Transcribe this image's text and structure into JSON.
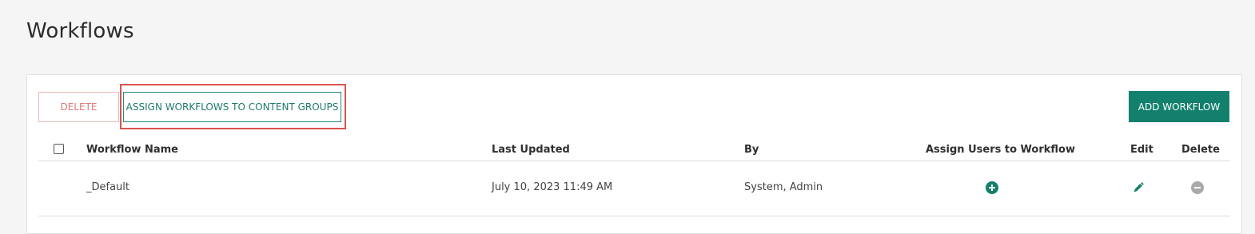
{
  "page": {
    "title": "Workflows"
  },
  "toolbar": {
    "delete_label": "DELETE",
    "assign_label": "ASSIGN WORKFLOWS TO CONTENT GROUPS",
    "add_label": "ADD WORKFLOW"
  },
  "table": {
    "columns": {
      "name": "Workflow Name",
      "updated": "Last Updated",
      "by": "By",
      "assign_users": "Assign Users to Workflow",
      "edit": "Edit",
      "delete": "Delete"
    },
    "rows": [
      {
        "name": "_Default",
        "updated": "July 10, 2023 11:49 AM",
        "by": "System, Admin"
      }
    ]
  },
  "colors": {
    "accent": "#13806d",
    "highlight": "#d9534f",
    "delete_disabled": "#e07a7a"
  },
  "icons": {
    "add_user": "plus-circle-icon",
    "edit": "pencil-icon",
    "delete": "minus-circle-icon"
  }
}
